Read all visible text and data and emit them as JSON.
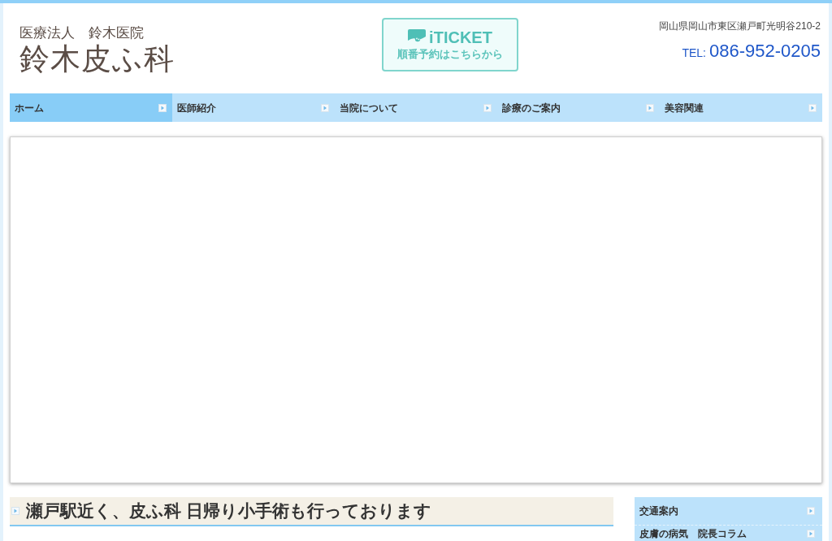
{
  "header": {
    "corporation": "医療法人　鈴木医院",
    "clinic_name": "鈴木皮ふ科",
    "reservation_button": {
      "brand": "iTICKET",
      "label": "順番予約はこちらから"
    },
    "address": "岡山県岡山市東区瀬戸町光明谷210-2",
    "tel_label": "TEL:",
    "tel_number": "086-952-0205"
  },
  "nav": [
    {
      "label": "ホーム",
      "selected": true
    },
    {
      "label": "医師紹介",
      "selected": false
    },
    {
      "label": "当院について",
      "selected": false
    },
    {
      "label": "診療のご案内",
      "selected": false
    },
    {
      "label": "美容関連",
      "selected": false
    }
  ],
  "main": {
    "heading": "瀬戸駅近く、皮ふ科 日帰り小手術も行っております"
  },
  "sidebar": {
    "items": [
      {
        "label": "交通案内"
      },
      {
        "label": "皮膚の病気　院長コラム"
      }
    ]
  }
}
